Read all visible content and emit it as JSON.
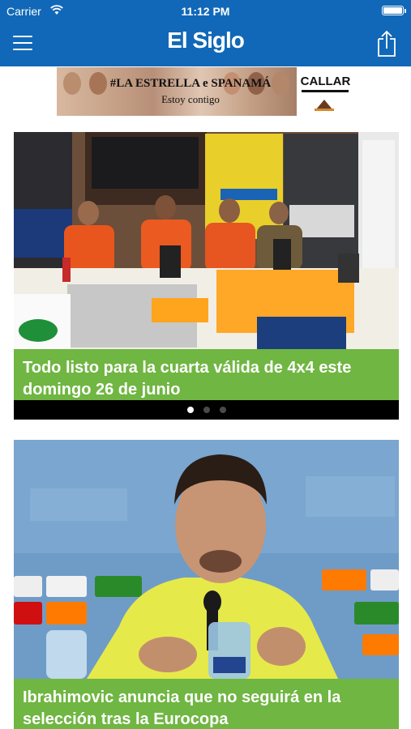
{
  "status_bar": {
    "carrier": "Carrier",
    "time": "11:12 PM"
  },
  "nav": {
    "logo": "El Siglo",
    "menu_icon": "hamburger-menu-icon",
    "share_icon": "share-icon"
  },
  "ad": {
    "headline": "#LA ESTRELLA e SPANAMÁ",
    "tagline": "Estoy contigo",
    "side_label": "CALLAR"
  },
  "carousel": {
    "page_count": 3,
    "active_index": 0
  },
  "articles": [
    {
      "title": "Todo listo para la cuarta válida de 4x4 este domingo 26 de junio"
    },
    {
      "title": "Ibrahimovic anuncia que no seguirá en la selección tras la Eurocopa"
    }
  ],
  "colors": {
    "header_blue": "#1168b8",
    "caption_green": "#68b238"
  }
}
